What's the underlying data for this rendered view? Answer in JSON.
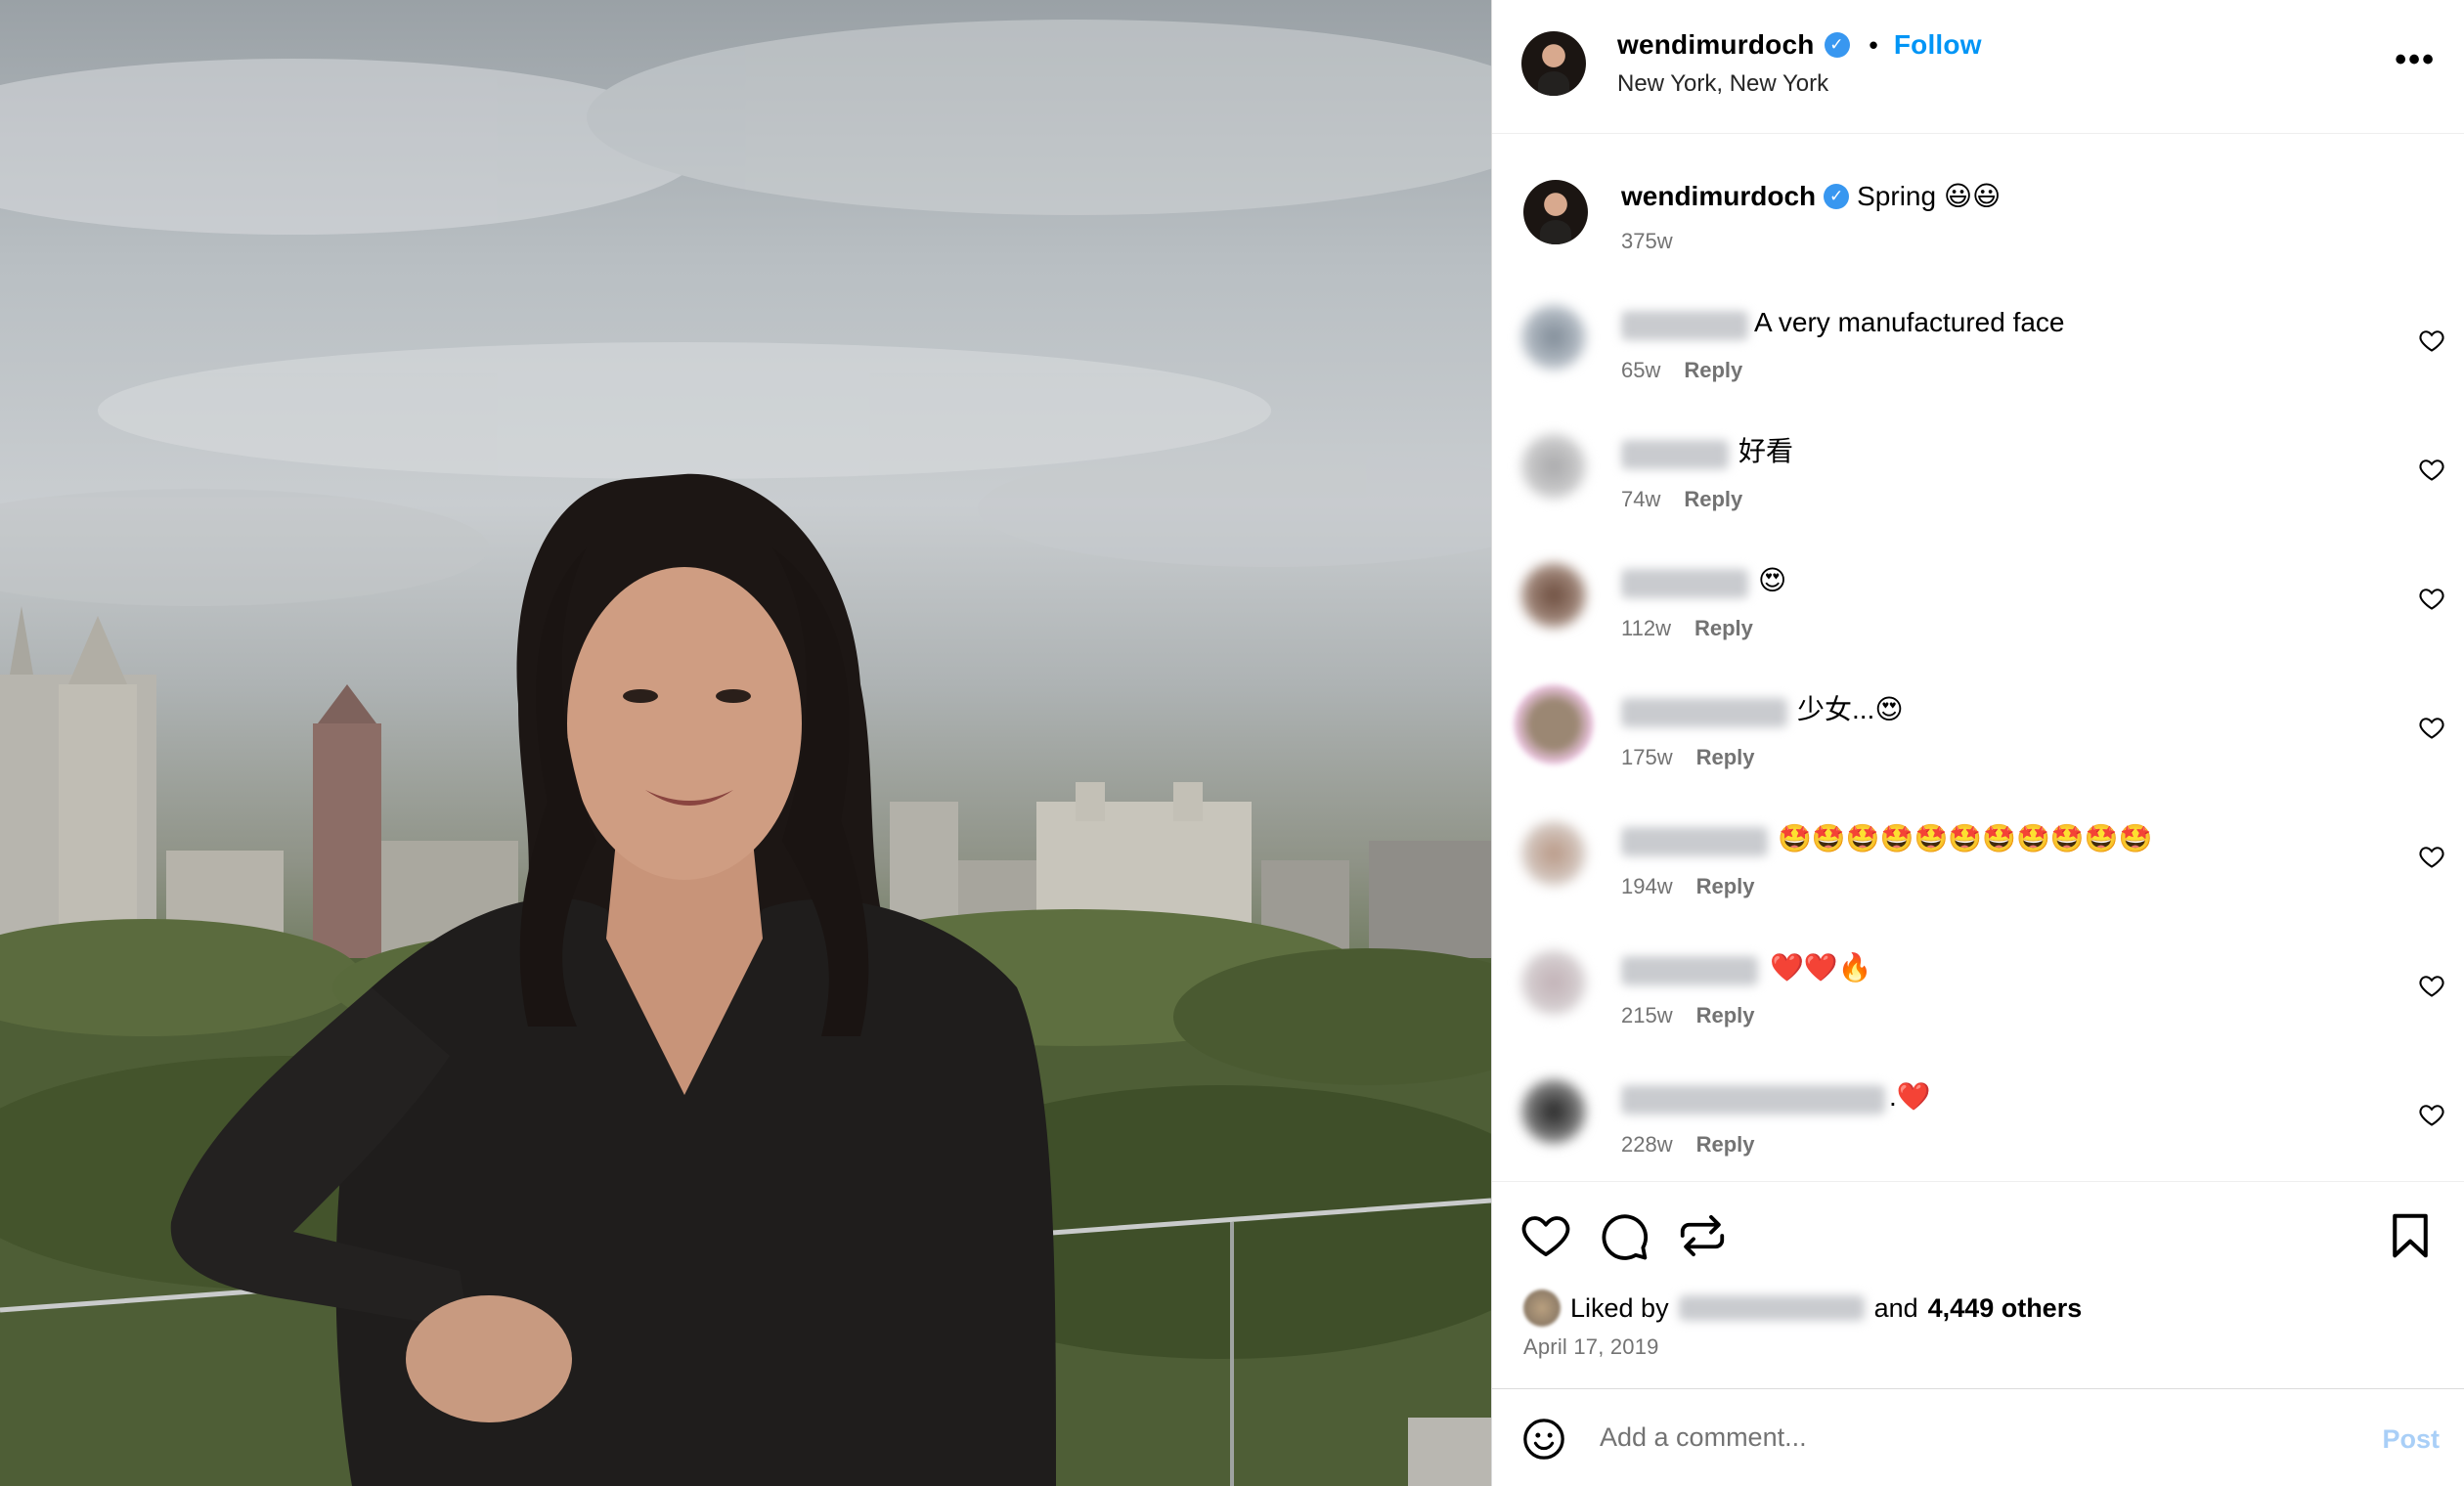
{
  "post": {
    "username": "wendimurdoch",
    "separator": "•",
    "follow_label": "Follow",
    "location": "New York, New York",
    "more_label": "•••"
  },
  "caption": {
    "username": "wendimurdoch",
    "text": "Spring 😃😃",
    "time": "375w"
  },
  "comments": [
    {
      "text": "A very manufactured face",
      "time": "65w",
      "reply": "Reply"
    },
    {
      "text": "好看",
      "time": "74w",
      "reply": "Reply"
    },
    {
      "text": "😍",
      "time": "112w",
      "reply": "Reply"
    },
    {
      "text": "少女...😍",
      "time": "175w",
      "reply": "Reply"
    },
    {
      "text": "🤩🤩🤩🤩🤩🤩🤩🤩🤩🤩🤩",
      "time": "194w",
      "reply": "Reply"
    },
    {
      "text": "❤️❤️🔥",
      "time": "215w",
      "reply": "Reply"
    },
    {
      "text": ".❤️",
      "time": "228w",
      "reply": "Reply"
    }
  ],
  "likes": {
    "prefix": "Liked by",
    "and": "and",
    "count": "4,449 others"
  },
  "date": "April 17, 2019",
  "composer": {
    "placeholder": "Add a comment...",
    "post_label": "Post"
  },
  "colors": {
    "link": "#0095f6",
    "verified": "#3897f0",
    "muted": "#737373",
    "post_disabled": "#a9cff7"
  }
}
